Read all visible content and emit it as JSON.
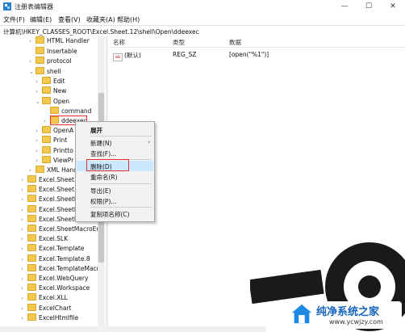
{
  "window": {
    "title": "注册表编辑器",
    "controls": {
      "minimize": "—",
      "maximize": "☐",
      "close": "✕"
    }
  },
  "menubar": [
    "文件(F)",
    "编辑(E)",
    "查看(V)",
    "收藏夹(A)",
    "帮助(H)"
  ],
  "address": "计算机\\HKEY_CLASSES_ROOT\\Excel.Sheet.12\\shell\\Open\\ddeexec",
  "tree": [
    {
      "label": "HTML Handler",
      "arrow": "›"
    },
    {
      "label": "Insertable",
      "arrow": ""
    },
    {
      "label": "protocol",
      "arrow": "›"
    },
    {
      "label": "shell",
      "arrow": "⌄"
    },
    {
      "label": "Edit",
      "arrow": "›"
    },
    {
      "label": "New",
      "arrow": "›"
    },
    {
      "label": "Open",
      "arrow": "⌄"
    },
    {
      "label": "command",
      "arrow": ""
    },
    {
      "label": "ddeexec",
      "arrow": "›"
    },
    {
      "label": "OpenA",
      "arrow": "›"
    },
    {
      "label": "Print",
      "arrow": "›"
    },
    {
      "label": "Printto",
      "arrow": "›"
    },
    {
      "label": "ViewPr",
      "arrow": "›"
    },
    {
      "label": "XML Hand",
      "arrow": "›"
    },
    {
      "label": "Excel.Sheet.5",
      "arrow": "›"
    },
    {
      "label": "Excel.Sheet.8",
      "arrow": "›"
    },
    {
      "label": "Excel.SheetB",
      "arrow": "›"
    },
    {
      "label": "Excel.SheetB",
      "arrow": "›"
    },
    {
      "label": "Excel.SheetM",
      "arrow": "›"
    },
    {
      "label": "Excel.SheetMacroEna",
      "arrow": "›"
    },
    {
      "label": "Excel.SLK",
      "arrow": "›"
    },
    {
      "label": "Excel.Template",
      "arrow": "›"
    },
    {
      "label": "Excel.Template.8",
      "arrow": "›"
    },
    {
      "label": "Excel.TemplateMacro",
      "arrow": "›"
    },
    {
      "label": "Excel.WebQuery",
      "arrow": "›"
    },
    {
      "label": "Excel.Workspace",
      "arrow": "›"
    },
    {
      "label": "Excel.XLL",
      "arrow": "›"
    },
    {
      "label": "ExcelChart",
      "arrow": "›"
    },
    {
      "label": "ExcelHtmlfile",
      "arrow": "›"
    }
  ],
  "list": {
    "headers": {
      "name": "名称",
      "type": "类型",
      "data": "数据"
    },
    "rows": [
      {
        "icon": "ab",
        "name": "(默认)",
        "type": "REG_SZ",
        "data": "[open(\"%1\")]"
      }
    ]
  },
  "context_menu": [
    {
      "label": "展开",
      "bold": true
    },
    {
      "label": "新建(N)",
      "submenu": "›"
    },
    {
      "label": "查找(F)..."
    },
    {
      "label": "删除(D)",
      "highlight": true
    },
    {
      "label": "重命名(R)"
    },
    {
      "label": "导出(E)"
    },
    {
      "label": "权限(P)..."
    },
    {
      "label": "复制项名称(C)"
    }
  ],
  "watermark": {
    "brand": "纯净系统之家",
    "url": "www.ycwjzy.com"
  },
  "colors": {
    "highlight": "#cce8ff",
    "redbox": "#e3302f",
    "folder": "#f2c94c"
  }
}
